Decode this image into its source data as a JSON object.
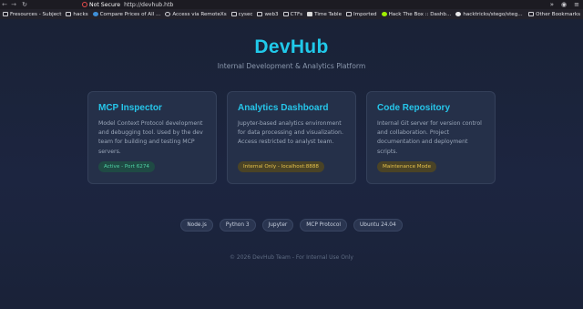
{
  "browser": {
    "security_label": "Not Secure",
    "url": "http://devhub.htb",
    "bookmarks": [
      {
        "label": "Fresources - Subject",
        "icon": "folder-icon"
      },
      {
        "label": "hacks",
        "icon": "folder-icon"
      },
      {
        "label": "Compare Prices of All ...",
        "icon": "site-icon"
      },
      {
        "label": "Access via RemoteXs",
        "icon": "globe-icon"
      },
      {
        "label": "cysec",
        "icon": "folder-icon"
      },
      {
        "label": "web3",
        "icon": "folder-icon"
      },
      {
        "label": "CTFs",
        "icon": "folder-icon"
      },
      {
        "label": "Time Table",
        "icon": "site-icon"
      },
      {
        "label": "Imported",
        "icon": "folder-icon"
      },
      {
        "label": "Hack The Box :: Dashb...",
        "icon": "htb-icon"
      },
      {
        "label": "hacktricks/stego/steg...",
        "icon": "github-icon"
      }
    ],
    "other_bookmarks": "Other Bookmarks"
  },
  "header": {
    "title": "DevHub",
    "subtitle": "Internal Development & Analytics Platform"
  },
  "cards": [
    {
      "title": "MCP Inspector",
      "description": "Model Context Protocol development and debugging tool. Used by the dev team for building and testing MCP servers.",
      "badge": "Active - Port 6274"
    },
    {
      "title": "Analytics Dashboard",
      "description": "Jupyter-based analytics environment for data processing and visualization. Access restricted to analyst team.",
      "badge": "Internal Only - localhost:8888"
    },
    {
      "title": "Code Repository",
      "description": "Internal Git server for version control and collaboration. Project documentation and deployment scripts.",
      "badge": "Maintenance Mode"
    }
  ],
  "tags": [
    "Node.js",
    "Python 3",
    "Jupyter",
    "MCP Protocol",
    "Ubuntu 24.04"
  ],
  "footer": "© 2026 DevHub Team - For Internal Use Only",
  "colors": {
    "accent": "#20c9ea",
    "background": "#1b2439",
    "card": "#253049",
    "status_active": "#4fd3a6",
    "status_warning": "#e6c24a"
  }
}
